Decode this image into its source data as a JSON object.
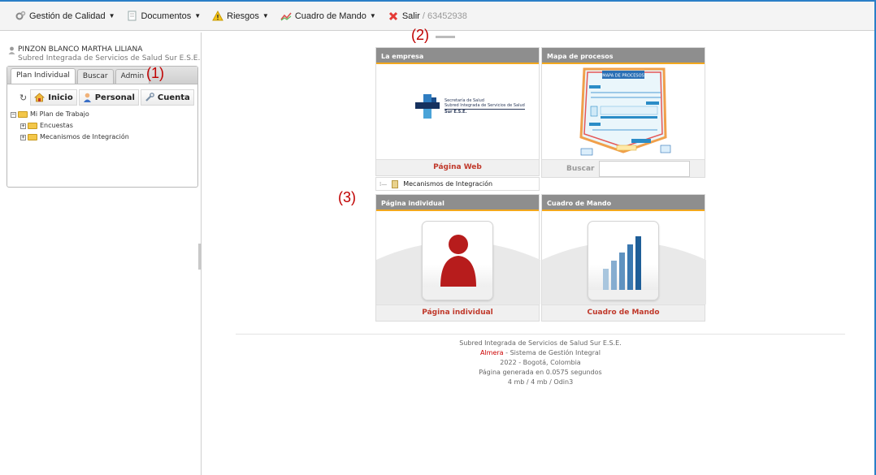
{
  "menu": {
    "items": [
      {
        "label": "Gestión de Calidad",
        "icon": "gears-icon",
        "caret": true
      },
      {
        "label": "Documentos",
        "icon": "document-icon",
        "caret": true
      },
      {
        "label": "Riesgos",
        "icon": "warning-icon",
        "caret": true
      },
      {
        "label": "Cuadro de Mando",
        "icon": "trend-icon",
        "caret": true
      },
      {
        "label": "Salir",
        "icon": "close-icon",
        "caret": false,
        "extra": "/ 63452938"
      }
    ]
  },
  "annotations": {
    "a1": "(1)",
    "a2": "(2)",
    "a3": "(3)"
  },
  "user": {
    "name": "PINZON BLANCO MARTHA LILIANA",
    "org": "Subred Integrada de Servicios de Salud Sur E.S.E."
  },
  "tabs": [
    "Plan Individual",
    "Buscar",
    "Admin"
  ],
  "toolbar": {
    "inicio": "Inicio",
    "personal": "Personal",
    "cuenta": "Cuenta"
  },
  "tree": {
    "root": "Mi Plan de Trabajo",
    "children": [
      "Encuestas",
      "Mecanismos de Integración"
    ]
  },
  "cards": {
    "empresa": {
      "title": "La empresa",
      "footer": "Página Web",
      "logo_lines": [
        "Secretaría de Salud",
        "Subred Integrada de Servicios de Salud",
        "Sur E.S.E."
      ]
    },
    "procesos": {
      "title": "Mapa de procesos",
      "map_title": "MAPA DE PROCESOS",
      "search_label": "Buscar"
    },
    "individual": {
      "title": "Página individual",
      "footer": "Página individual"
    },
    "mando": {
      "title": "Cuadro de Mando",
      "footer": "Cuadro de Mando"
    }
  },
  "subtree": {
    "label": "Mecanismos de Integración"
  },
  "footer": {
    "line1": "Subred Integrada de Servicios de Salud Sur E.S.E.",
    "brand": "Almera",
    "line2_rest": " - Sistema de Gestión Integral",
    "line3": "2022 - Bogotá, Colombia",
    "line4": "Página generada en 0.0575 segundos",
    "line5": "4 mb / 4 mb / Odin3"
  },
  "colors": {
    "frame": "#2a7fc7",
    "card_header": "#8e8e8e",
    "card_accent": "#f2a81d",
    "link_red": "#c0392b",
    "annotation": "#c00000"
  }
}
